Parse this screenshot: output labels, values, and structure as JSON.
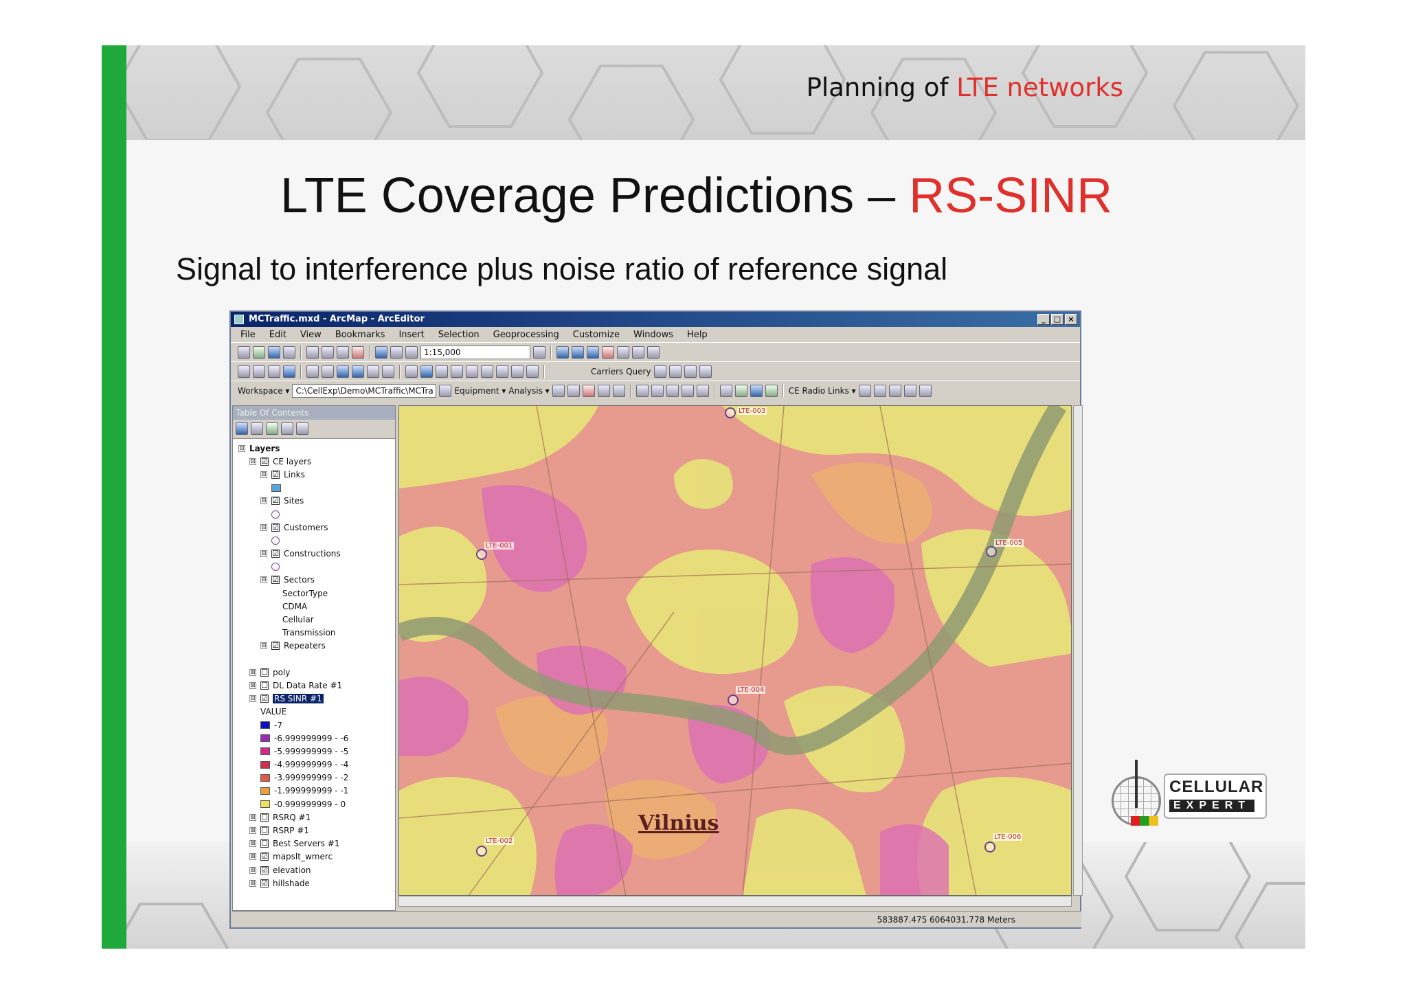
{
  "header": {
    "prefix": "Planning of ",
    "highlight": "LTE networks"
  },
  "slide": {
    "title_main": "LTE Coverage Predictions – ",
    "title_accent": "RS-SINR",
    "subtitle": "Signal to interference plus noise ratio of reference signal"
  },
  "arcmap": {
    "window_title": "MCTraffic.mxd - ArcMap - ArcEditor",
    "window_buttons": [
      "_",
      "□",
      "×"
    ],
    "menu": [
      "File",
      "Edit",
      "View",
      "Bookmarks",
      "Insert",
      "Selection",
      "Geoprocessing",
      "Customize",
      "Windows",
      "Help"
    ],
    "scale": "1:15,000",
    "toolbar3_label": "Carriers Query",
    "workspace_label": "Workspace ▾",
    "workspace_path": "C:\\CellExp\\Demo\\MCTraffic\\MCTra",
    "equipment_label": "Equipment ▾",
    "analysis_label": "Analysis ▾",
    "radio_links_label": "CE Radio Links ▾",
    "toc_title": "Table Of Contents",
    "coords": "583887.475  6064031.778 Meters"
  },
  "toc": [
    {
      "indent": 0,
      "expander": "⊟",
      "check": null,
      "label": "Layers",
      "bold": true
    },
    {
      "indent": 1,
      "expander": "⊟",
      "check": "☑",
      "label": "CE layers"
    },
    {
      "indent": 2,
      "expander": "⊟",
      "check": "☑",
      "label": "Links"
    },
    {
      "indent": 3,
      "swatch": "#59a7d8",
      "label": ""
    },
    {
      "indent": 2,
      "expander": "⊟",
      "check": "☑",
      "label": "Sites"
    },
    {
      "indent": 3,
      "symbol": true,
      "label": ""
    },
    {
      "indent": 2,
      "expander": "⊟",
      "check": "☑",
      "label": "Customers"
    },
    {
      "indent": 3,
      "symbol": true,
      "label": ""
    },
    {
      "indent": 2,
      "expander": "⊟",
      "check": "☑",
      "label": "Constructions"
    },
    {
      "indent": 3,
      "symbol": true,
      "label": ""
    },
    {
      "indent": 2,
      "expander": "⊟",
      "check": "☑",
      "label": "Sectors"
    },
    {
      "indent": 4,
      "label": "SectorType"
    },
    {
      "indent": 4,
      "label": "CDMA"
    },
    {
      "indent": 4,
      "label": "Cellular"
    },
    {
      "indent": 4,
      "label": "Transmission"
    },
    {
      "indent": 2,
      "expander": "⊟",
      "check": "☑",
      "label": "Repeaters"
    },
    {
      "indent": 3,
      "label": ""
    },
    {
      "indent": 1,
      "expander": "⊞",
      "check": "☐",
      "label": "poly"
    },
    {
      "indent": 1,
      "expander": "⊞",
      "check": "☐",
      "label": "DL Data Rate #1"
    },
    {
      "indent": 1,
      "expander": "⊟",
      "check": "☑",
      "label": "RS SINR #1",
      "selected": true
    },
    {
      "indent": 2,
      "label": "VALUE"
    },
    {
      "indent": 2,
      "swatch": "#1010c0",
      "label": "-7"
    },
    {
      "indent": 2,
      "swatch": "#9b2ab5",
      "label": "-6.999999999 - -6"
    },
    {
      "indent": 2,
      "swatch": "#d02a8a",
      "label": "-5.999999999 - -5"
    },
    {
      "indent": 2,
      "swatch": "#d0304a",
      "label": "-4.999999999 - -4"
    },
    {
      "indent": 2,
      "swatch": "#e05a4a",
      "label": "-3.999999999 - -2"
    },
    {
      "indent": 2,
      "swatch": "#e8a040",
      "label": "-1.999999999 - -1"
    },
    {
      "indent": 2,
      "swatch": "#f0e060",
      "label": "-0.999999999 - 0"
    },
    {
      "indent": 1,
      "expander": "⊞",
      "check": "☐",
      "label": "RSRQ #1"
    },
    {
      "indent": 1,
      "expander": "⊞",
      "check": "☐",
      "label": "RSRP #1"
    },
    {
      "indent": 1,
      "expander": "⊞",
      "check": "☐",
      "label": "Best Servers #1"
    },
    {
      "indent": 1,
      "expander": "⊞",
      "check": "☑",
      "label": "mapslt_wmerc"
    },
    {
      "indent": 1,
      "expander": "⊞",
      "check": "☑",
      "label": "elevation"
    },
    {
      "indent": 1,
      "expander": "⊞",
      "check": "☑",
      "label": "hillshade"
    }
  ],
  "sites": [
    {
      "label": "LTE-003"
    },
    {
      "label": "LTE-001"
    },
    {
      "label": "LTE-005"
    },
    {
      "label": "LTE-004"
    },
    {
      "label": "LTE-002"
    },
    {
      "label": "LTE-006"
    }
  ],
  "map_city": "Vilnius",
  "logo": {
    "line1": "CELLULAR",
    "line2": "EXPERT"
  },
  "colors": {
    "accent_red": "#e0302b",
    "green_bar": "#1fa83b",
    "title_blue": "#0a246a"
  }
}
